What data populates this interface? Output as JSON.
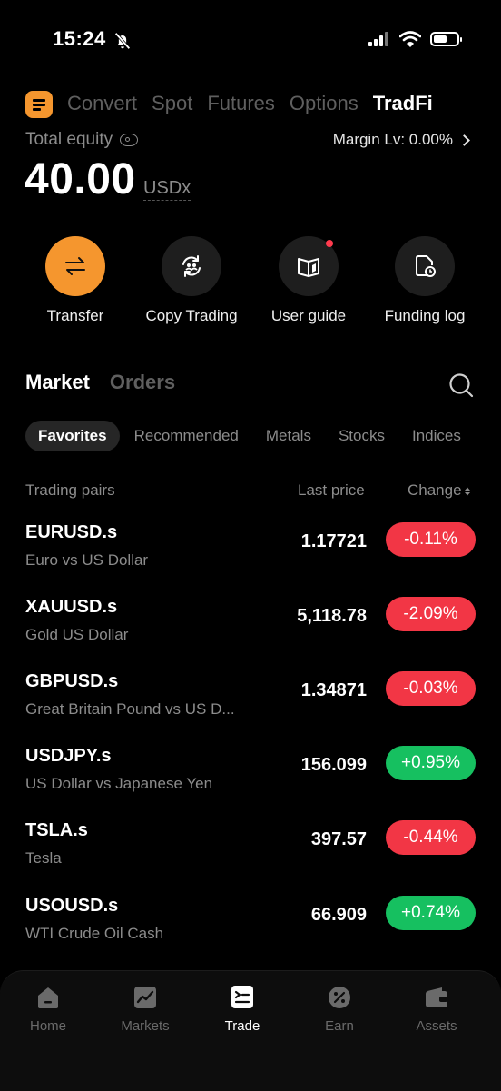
{
  "status": {
    "time": "15:24"
  },
  "top_tabs": [
    {
      "label": "Convert",
      "active": false
    },
    {
      "label": "Spot",
      "active": false
    },
    {
      "label": "Futures",
      "active": false
    },
    {
      "label": "Options",
      "active": false
    },
    {
      "label": "TradFi",
      "active": true
    }
  ],
  "equity": {
    "label": "Total equity",
    "value": "40.00",
    "unit": "USDx",
    "margin": "Margin Lv: 0.00%"
  },
  "actions": [
    {
      "label": "Transfer",
      "icon": "transfer-icon"
    },
    {
      "label": "Copy Trading",
      "icon": "copy-trading-icon"
    },
    {
      "label": "User guide",
      "icon": "user-guide-icon"
    },
    {
      "label": "Funding log",
      "icon": "funding-log-icon"
    }
  ],
  "market": {
    "tabs": [
      {
        "label": "Market",
        "active": true
      },
      {
        "label": "Orders",
        "active": false
      }
    ],
    "filters": [
      {
        "label": "Favorites",
        "active": true
      },
      {
        "label": "Recommended",
        "active": false
      },
      {
        "label": "Metals",
        "active": false
      },
      {
        "label": "Stocks",
        "active": false
      },
      {
        "label": "Indices",
        "active": false
      }
    ],
    "columns": {
      "pair": "Trading pairs",
      "price": "Last price",
      "change": "Change"
    },
    "rows": [
      {
        "symbol": "EURUSD.s",
        "name": "Euro vs US Dollar",
        "price": "1.17721",
        "change": "-0.11%",
        "direction": "down"
      },
      {
        "symbol": "XAUUSD.s",
        "name": "Gold US Dollar",
        "price": "5,118.78",
        "change": "-2.09%",
        "direction": "down"
      },
      {
        "symbol": "GBPUSD.s",
        "name": "Great Britain Pound vs US D...",
        "price": "1.34871",
        "change": "-0.03%",
        "direction": "down"
      },
      {
        "symbol": "USDJPY.s",
        "name": "US Dollar vs Japanese Yen",
        "price": "156.099",
        "change": "+0.95%",
        "direction": "up"
      },
      {
        "symbol": "TSLA.s",
        "name": "Tesla",
        "price": "397.57",
        "change": "-0.44%",
        "direction": "down"
      },
      {
        "symbol": "USOUSD.s",
        "name": "WTI Crude Oil Cash",
        "price": "66.909",
        "change": "+0.74%",
        "direction": "up"
      }
    ]
  },
  "nav": [
    {
      "label": "Home",
      "icon": "home-icon",
      "active": false
    },
    {
      "label": "Markets",
      "icon": "markets-icon",
      "active": false
    },
    {
      "label": "Trade",
      "icon": "trade-icon",
      "active": true
    },
    {
      "label": "Earn",
      "icon": "earn-icon",
      "active": false
    },
    {
      "label": "Assets",
      "icon": "assets-icon",
      "active": false
    }
  ],
  "colors": {
    "accent": "#f5962e",
    "down": "#f23645",
    "up": "#16c060",
    "background": "#000000"
  }
}
